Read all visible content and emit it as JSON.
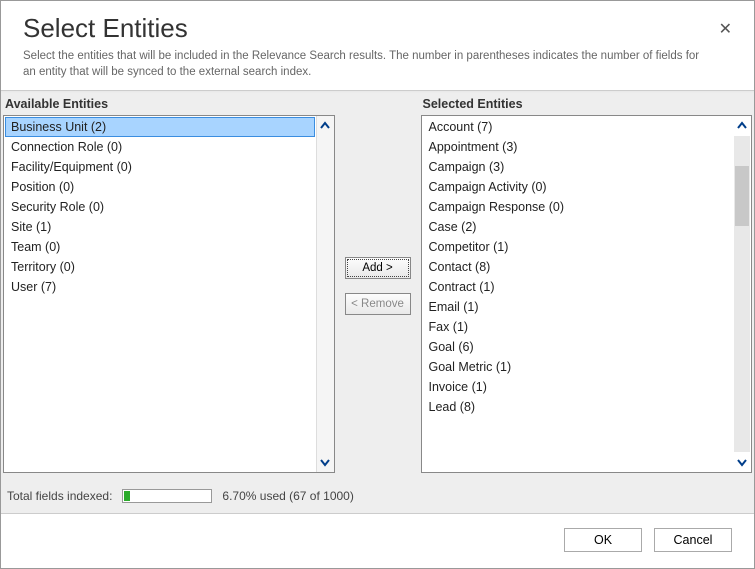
{
  "header": {
    "title": "Select Entities",
    "description": "Select the entities that will be included in the Relevance Search results. The number in parentheses indicates the number of fields for an entity that will be synced to the external search index."
  },
  "labels": {
    "available": "Available Entities",
    "selected": "Selected Entities",
    "add": "Add >",
    "remove": "< Remove",
    "ok": "OK",
    "cancel": "Cancel"
  },
  "available": {
    "items": [
      {
        "label": "Business Unit (2)",
        "selected": true
      },
      {
        "label": "Connection Role (0)"
      },
      {
        "label": "Facility/Equipment (0)"
      },
      {
        "label": "Position (0)"
      },
      {
        "label": "Security Role (0)"
      },
      {
        "label": "Site (1)"
      },
      {
        "label": "Team (0)"
      },
      {
        "label": "Territory (0)"
      },
      {
        "label": "User (7)"
      }
    ]
  },
  "selected": {
    "items": [
      {
        "label": "Account (7)"
      },
      {
        "label": "Appointment (3)"
      },
      {
        "label": "Campaign (3)"
      },
      {
        "label": "Campaign Activity (0)"
      },
      {
        "label": "Campaign Response (0)"
      },
      {
        "label": "Case (2)"
      },
      {
        "label": "Competitor (1)"
      },
      {
        "label": "Contact (8)"
      },
      {
        "label": "Contract (1)"
      },
      {
        "label": "Email (1)"
      },
      {
        "label": "Fax (1)"
      },
      {
        "label": "Goal (6)"
      },
      {
        "label": "Goal Metric (1)"
      },
      {
        "label": "Invoice (1)"
      },
      {
        "label": "Lead (8)"
      }
    ]
  },
  "status": {
    "label": "Total fields indexed:",
    "percent_text": "6.70% used (67 of 1000)",
    "fill_percent": 6.7
  }
}
